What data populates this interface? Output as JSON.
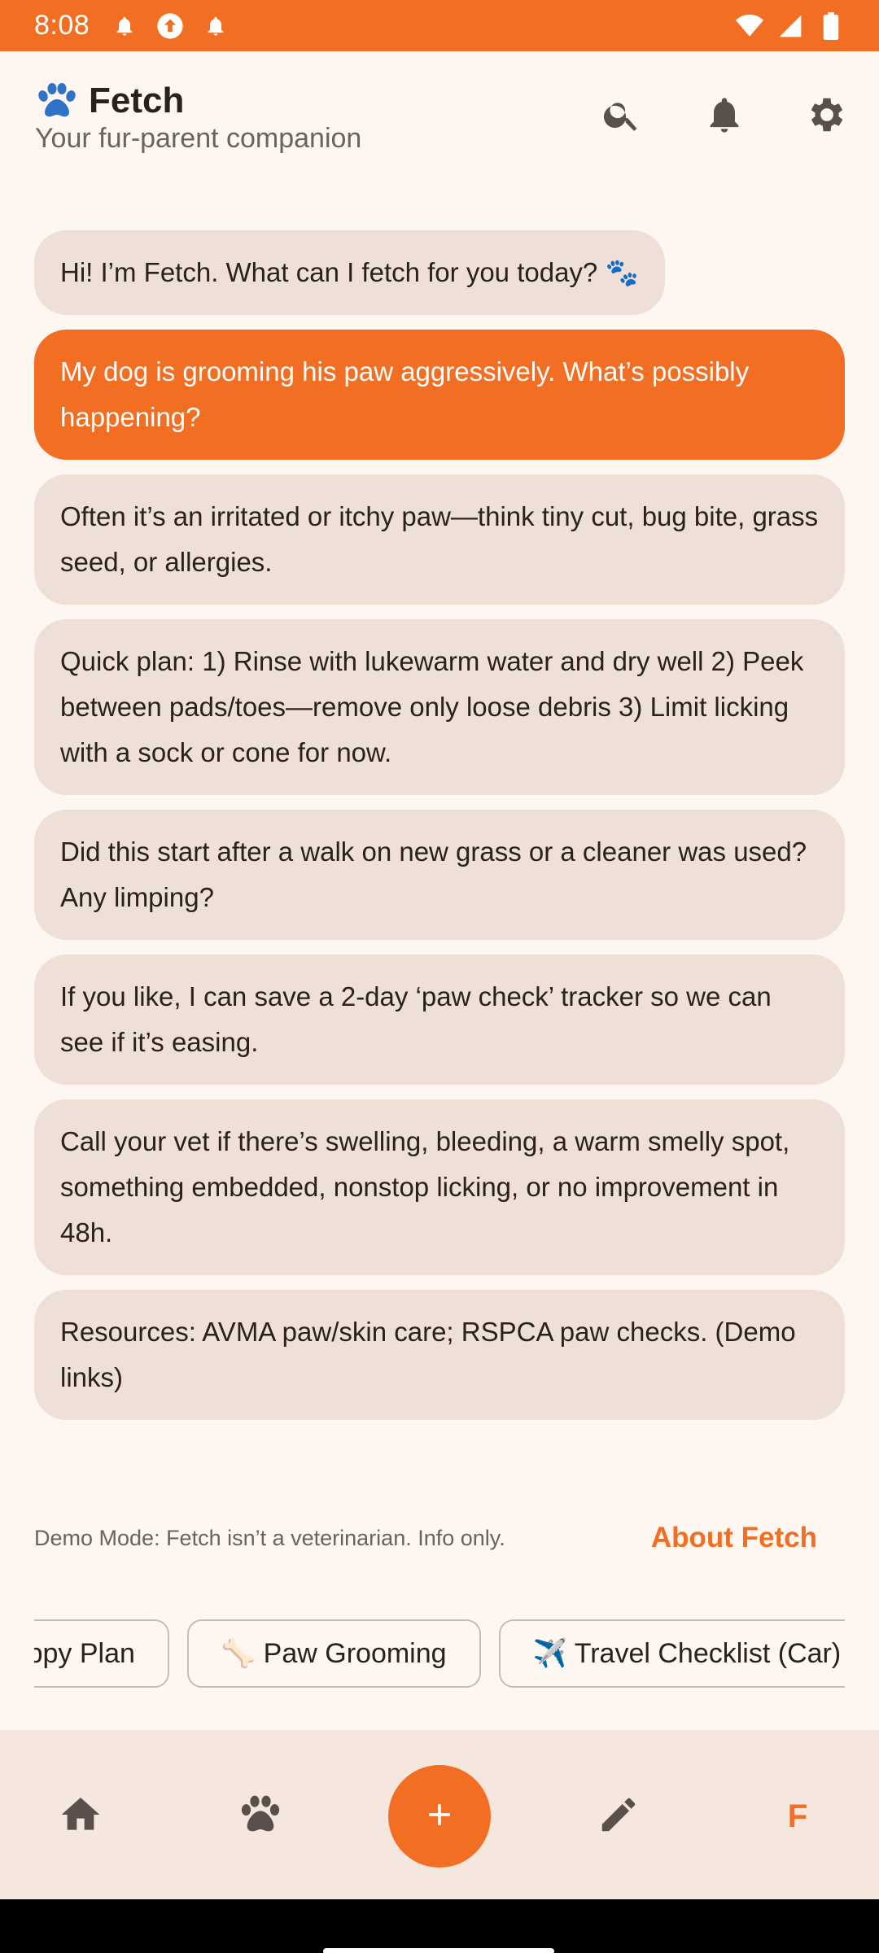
{
  "status_bar": {
    "time": "8:08",
    "background": "#F26E22"
  },
  "header": {
    "title": "Fetch",
    "subtitle": "Your fur-parent companion",
    "icons": [
      "paw-logo-icon",
      "search-icon",
      "bell-icon",
      "gear-icon"
    ]
  },
  "chat": {
    "messages": [
      {
        "role": "bot",
        "text": "Hi! I’m Fetch. What can I fetch for you today? 🐾"
      },
      {
        "role": "user",
        "text": "My dog is grooming his paw aggressively. What’s possibly happening?"
      },
      {
        "role": "bot",
        "text": "Often it’s an irritated or itchy paw—think tiny cut, bug bite, grass seed, or allergies."
      },
      {
        "role": "bot",
        "text": "Quick plan: 1) Rinse with lukewarm water and dry well 2) Peek between pads/toes—remove only loose debris 3) Limit licking with a sock or cone for now."
      },
      {
        "role": "bot",
        "text": "Did this start after a walk on new grass or a cleaner was used? Any limping?"
      },
      {
        "role": "bot",
        "text": "If you like, I can save a 2-day ‘paw check’ tracker so we can see if it’s easing."
      },
      {
        "role": "bot",
        "text": "Call your vet if there’s swelling, bleeding, a warm smelly spot, something embedded, nonstop licking, or no improvement in 48h."
      },
      {
        "role": "bot",
        "text": "Resources: AVMA paw/skin care; RSPCA paw checks. (Demo links)"
      }
    ]
  },
  "footer": {
    "disclaimer": "Demo Mode: Fetch isn’t a veterinarian. Info only.",
    "about_link": "About Fetch"
  },
  "chips": [
    "Puppy Plan",
    "🦴 Paw Grooming",
    "✈️ Travel Checklist (Car)"
  ],
  "bottom_nav": {
    "items": [
      "home-icon",
      "paw-icon",
      "add-icon",
      "pencil-icon",
      "F"
    ]
  },
  "colors": {
    "accent": "#F26E22",
    "bubble_bot": "#EEE0D7",
    "background": "#FDF6F1",
    "nav_background": "#F5E7DE"
  }
}
